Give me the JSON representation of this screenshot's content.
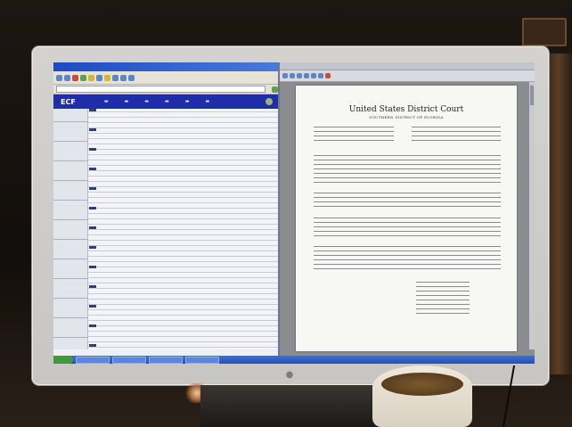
{
  "scene": {
    "description_tag": "photo-of-monitor",
    "clock_text": ""
  },
  "browser": {
    "banner_logo": "ECF"
  },
  "pdf_viewer": {
    "court_title": "United States District Court",
    "court_subtitle": "SOUTHERN DISTRICT OF FLORIDA"
  }
}
